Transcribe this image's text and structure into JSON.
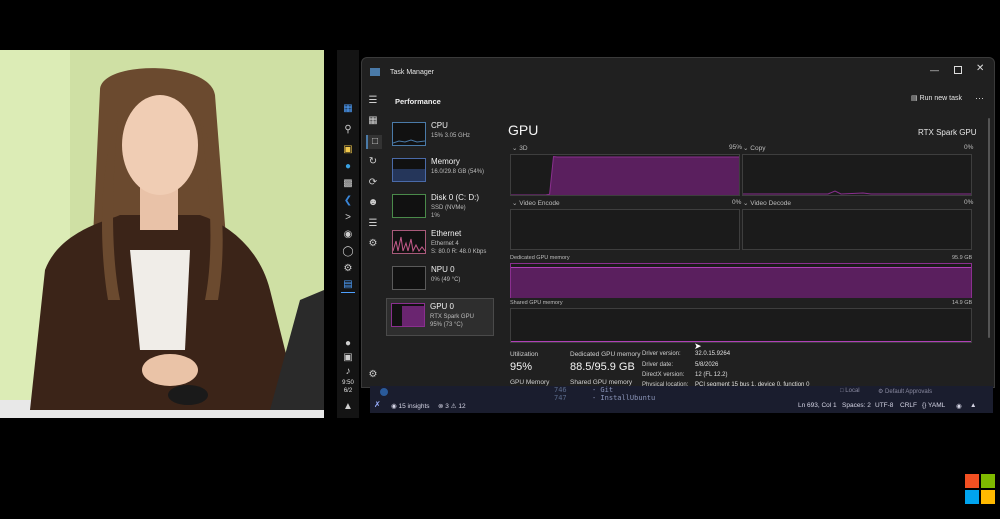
{
  "taskbar": {
    "time": "9:50",
    "date": "6/2"
  },
  "window": {
    "title": "Task Manager",
    "section_title": "Performance",
    "run_new_task_label": "Run new task",
    "more_label": "···"
  },
  "devices": [
    {
      "name": "CPU",
      "detail": "15%  3.05 GHz"
    },
    {
      "name": "Memory",
      "detail": "16.0/29.8 GB (54%)"
    },
    {
      "name": "Disk 0 (C: D:)",
      "detail": "SSD (NVMe)",
      "detail2": "1%"
    },
    {
      "name": "Ethernet",
      "detail": "Ethernet 4",
      "detail2": "S: 80.0  R: 48.0 Kbps"
    },
    {
      "name": "NPU 0",
      "detail": "0%  (49 °C)"
    },
    {
      "name": "GPU 0",
      "detail": "RTX Spark GPU",
      "detail2": "95%  (73 °C)"
    }
  ],
  "gpu": {
    "heading": "GPU",
    "model": "RTX Spark GPU",
    "graph_3d_label": "3D",
    "graph_3d_pct": "95%",
    "graph_copy_label": "Copy",
    "graph_copy_pct": "0%",
    "graph_encode_label": "Video Encode",
    "graph_encode_pct": "0%",
    "graph_decode_label": "Video Decode",
    "graph_decode_pct": "0%",
    "dedicated_label": "Dedicated GPU memory",
    "dedicated_max": "95.9 GB",
    "shared_label": "Shared GPU memory",
    "shared_max": "14.9 GB",
    "stats": {
      "utilization_label": "Utilization",
      "utilization_value": "95%",
      "dedicated_mem_label": "Dedicated GPU memory",
      "dedicated_mem_value": "88.5/95.9 GB",
      "gpu_memory_label": "GPU Memory",
      "shared_mem_label": "Shared GPU memory"
    },
    "info": {
      "driver_version_label": "Driver version:",
      "driver_version_value": "32.0.15.9264",
      "driver_date_label": "Driver date:",
      "driver_date_value": "5/8/2026",
      "directx_label": "DirectX version:",
      "directx_value": "12 (FL 12.2)",
      "physical_label": "Physical location:",
      "physical_value": "PCI segment 15 bus 1, device 0, function 0"
    },
    "graph_3d_series": [
      0,
      0,
      0,
      0,
      0,
      0,
      0,
      0,
      0,
      0,
      2,
      96,
      95,
      95,
      95,
      95,
      95,
      95,
      95,
      95,
      95,
      95,
      95,
      95,
      95,
      95,
      95,
      95,
      95,
      95,
      95,
      95,
      95,
      95,
      95,
      95,
      95,
      95,
      95,
      95,
      95,
      95,
      95,
      95,
      95,
      95,
      95,
      95,
      95,
      95,
      95,
      95,
      95,
      95,
      95,
      95,
      95,
      95,
      95,
      95
    ]
  },
  "vscode": {
    "line_num_a": "746",
    "line_num_b": "747",
    "code_a": "- Git",
    "code_b": "- InstallUbuntu",
    "local_label": "Local",
    "approvals_label": "Default Approvals",
    "insights_label": "15 insights",
    "errors_label": "3",
    "warnings_label": "12",
    "position_label": "Ln 693, Col 1",
    "spaces_label": "Spaces: 2",
    "encoding_label": "UTF-8",
    "eol_label": "CRLF",
    "lang_label": "{} YAML"
  },
  "colors": {
    "gpu_purple": "#8a2f8f",
    "gpu_fill": "#5a1f5e",
    "accent_blue": "#4a7aa8"
  }
}
